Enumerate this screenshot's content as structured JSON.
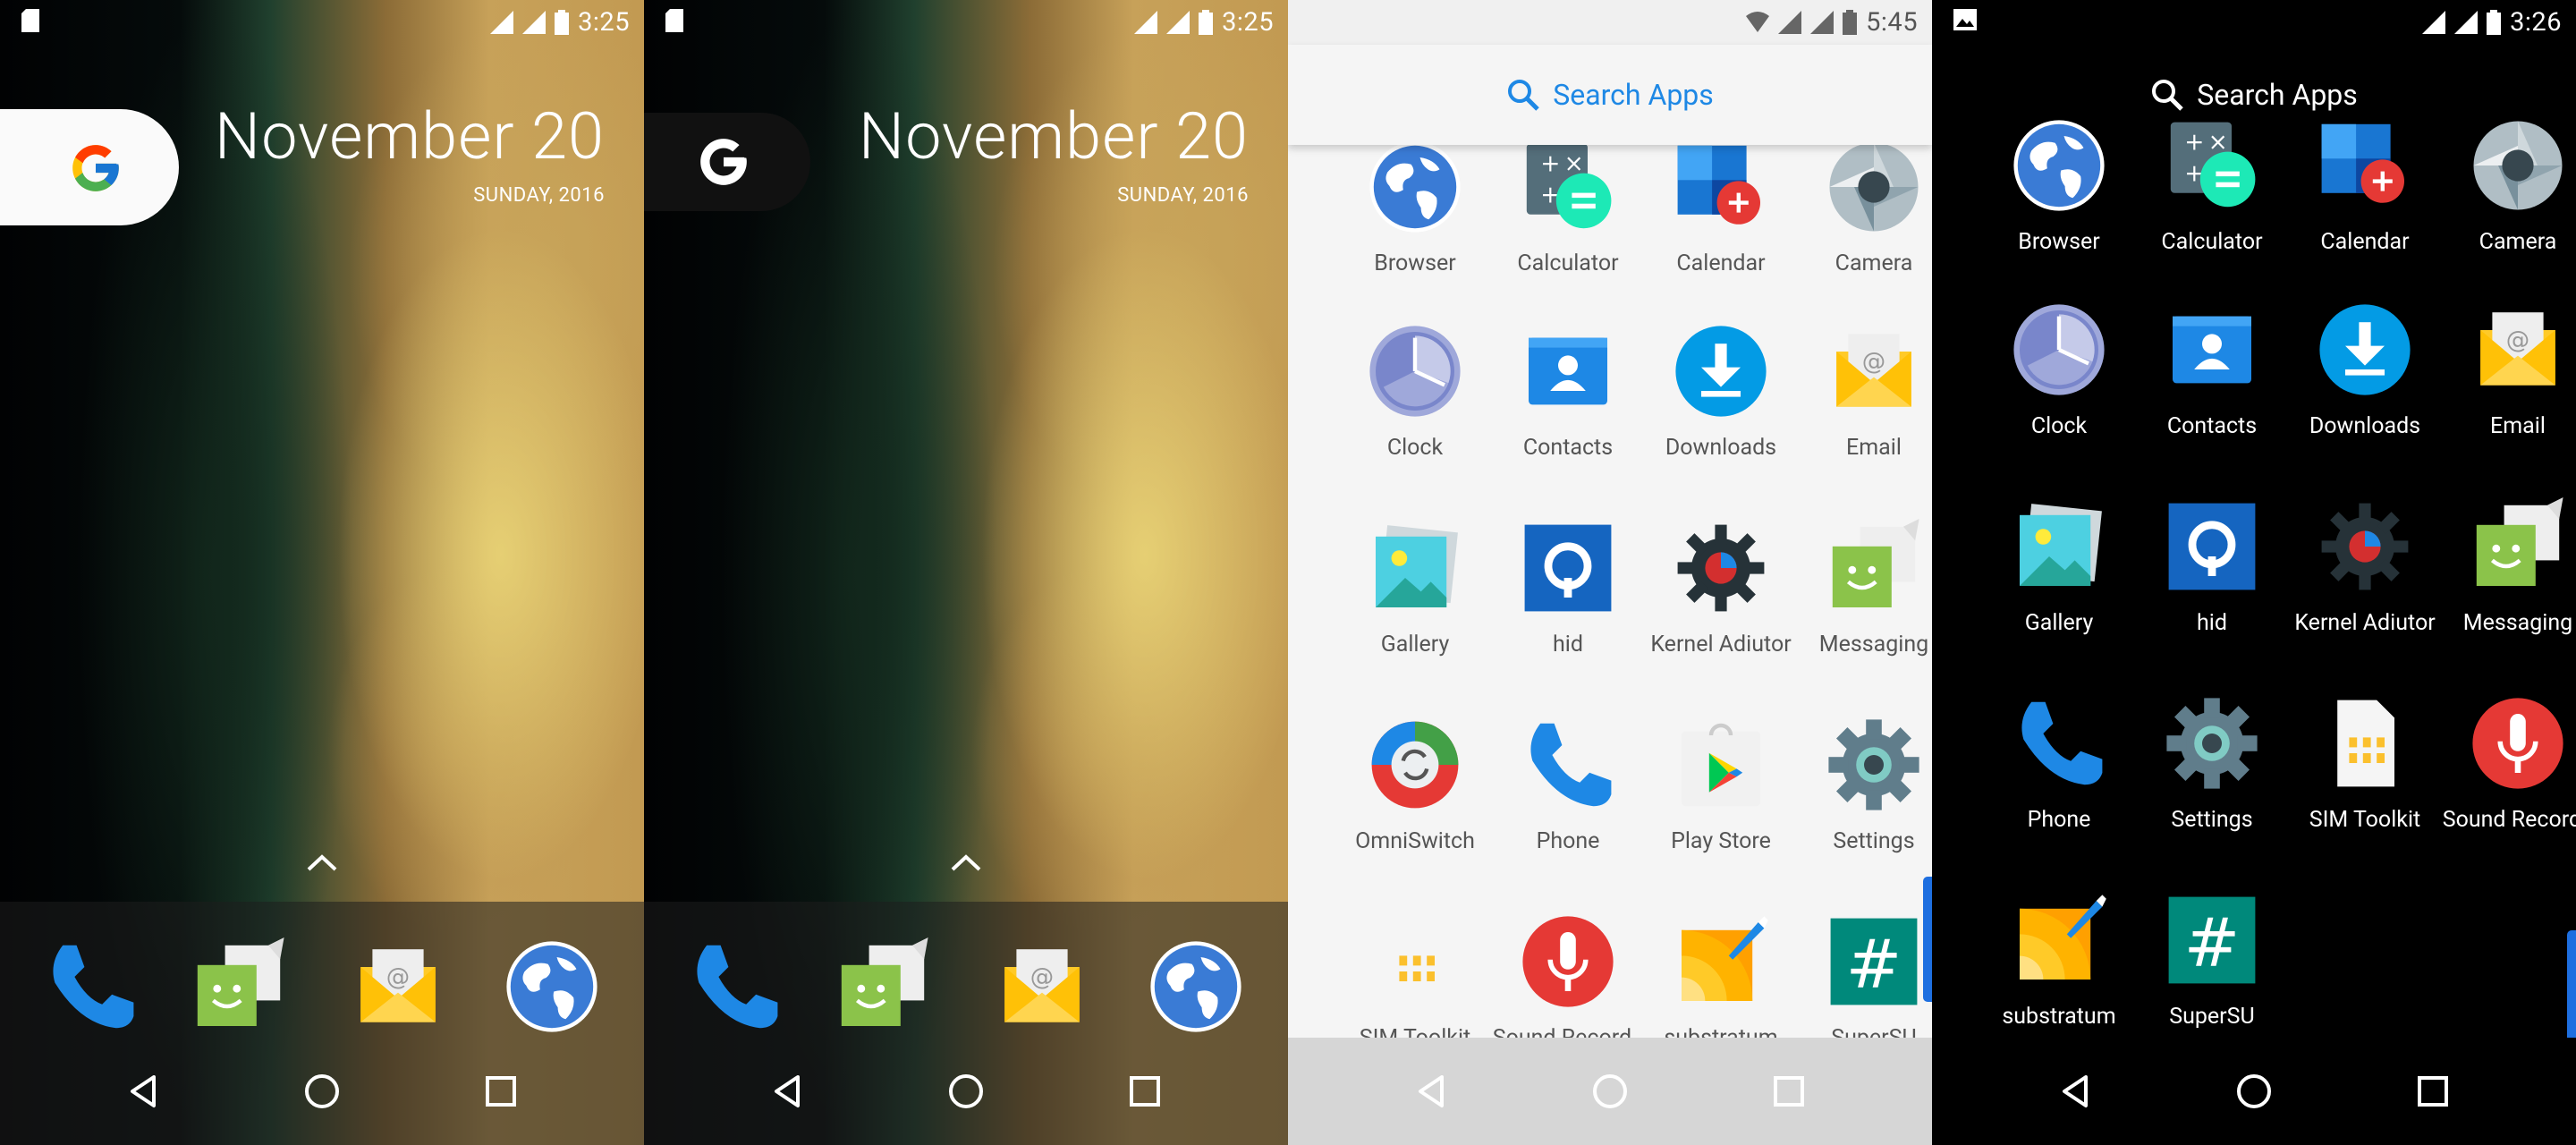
{
  "status": {
    "panel1_time": "3:25",
    "panel2_time": "3:25",
    "panel3_time": "5:45",
    "panel4_time": "3:26"
  },
  "home": {
    "date": "November 20",
    "day": "SUNDAY, 2016"
  },
  "drawer": {
    "search_label": "Search Apps",
    "light_apps": [
      {
        "label": "Browser",
        "icon": "browser-icon"
      },
      {
        "label": "Calculator",
        "icon": "calculator-icon"
      },
      {
        "label": "Calendar",
        "icon": "calendar-icon"
      },
      {
        "label": "Camera",
        "icon": "camera-icon"
      },
      {
        "label": "Clock",
        "icon": "clock-icon"
      },
      {
        "label": "Contacts",
        "icon": "contacts-icon"
      },
      {
        "label": "Downloads",
        "icon": "downloads-icon"
      },
      {
        "label": "Email",
        "icon": "email-icon"
      },
      {
        "label": "Gallery",
        "icon": "gallery-icon"
      },
      {
        "label": "hid",
        "icon": "hid-icon"
      },
      {
        "label": "Kernel Adiutor",
        "icon": "kernel-adiutor-icon"
      },
      {
        "label": "Messaging",
        "icon": "messaging-icon"
      },
      {
        "label": "OmniSwitch",
        "icon": "omniswitch-icon"
      },
      {
        "label": "Phone",
        "icon": "phone-icon"
      },
      {
        "label": "Play Store",
        "icon": "play-store-icon"
      },
      {
        "label": "Settings",
        "icon": "settings-icon"
      },
      {
        "label": "SIM Toolkit",
        "icon": "sim-toolkit-icon"
      },
      {
        "label": "Sound Record..",
        "icon": "sound-recorder-icon"
      },
      {
        "label": "substratum",
        "icon": "substratum-icon"
      },
      {
        "label": "SuperSU",
        "icon": "supersu-icon"
      }
    ],
    "dark_apps": [
      {
        "label": "Browser",
        "icon": "browser-icon"
      },
      {
        "label": "Calculator",
        "icon": "calculator-icon"
      },
      {
        "label": "Calendar",
        "icon": "calendar-icon"
      },
      {
        "label": "Camera",
        "icon": "camera-icon"
      },
      {
        "label": "Clock",
        "icon": "clock-icon"
      },
      {
        "label": "Contacts",
        "icon": "contacts-icon"
      },
      {
        "label": "Downloads",
        "icon": "downloads-icon"
      },
      {
        "label": "Email",
        "icon": "email-icon"
      },
      {
        "label": "Gallery",
        "icon": "gallery-icon"
      },
      {
        "label": "hid",
        "icon": "hid-icon"
      },
      {
        "label": "Kernel Adiutor",
        "icon": "kernel-adiutor-icon"
      },
      {
        "label": "Messaging",
        "icon": "messaging-icon"
      },
      {
        "label": "Phone",
        "icon": "phone-icon"
      },
      {
        "label": "Settings",
        "icon": "settings-icon"
      },
      {
        "label": "SIM Toolkit",
        "icon": "sim-toolkit-icon"
      },
      {
        "label": "Sound Record..",
        "icon": "sound-recorder-icon"
      },
      {
        "label": "substratum",
        "icon": "substratum-icon"
      },
      {
        "label": "SuperSU",
        "icon": "supersu-icon"
      }
    ]
  },
  "dock_icons": [
    "phone-icon",
    "messaging-icon",
    "email-icon",
    "browser-icon"
  ],
  "colors": {
    "accent_blue": "#1e88e5",
    "drawer_light_bg": "#f5f5f5",
    "drawer_dark_bg": "#000000"
  }
}
